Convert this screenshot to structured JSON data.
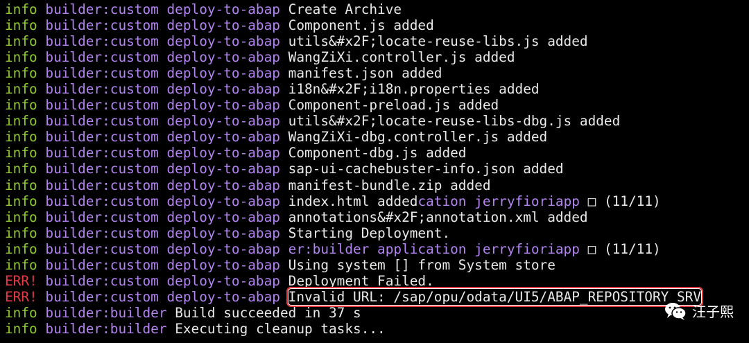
{
  "colors": {
    "info": "#8fcc2d",
    "err": "#e63b47",
    "source": "#b383f2",
    "msg": "#e9e9e9",
    "highlight_box": "#e0373d"
  },
  "terminal": {
    "lines": [
      {
        "level": "info",
        "source": "builder:custom deploy-to-abap",
        "message": "Create Archive"
      },
      {
        "level": "info",
        "source": "builder:custom deploy-to-abap",
        "message": "Component.js added"
      },
      {
        "level": "info",
        "source": "builder:custom deploy-to-abap",
        "message": "utils&#x2F;locate-reuse-libs.js added"
      },
      {
        "level": "info",
        "source": "builder:custom deploy-to-abap",
        "message": "WangZiXi.controller.js added"
      },
      {
        "level": "info",
        "source": "builder:custom deploy-to-abap",
        "message": "manifest.json added"
      },
      {
        "level": "info",
        "source": "builder:custom deploy-to-abap",
        "message": "i18n&#x2F;i18n.properties added"
      },
      {
        "level": "info",
        "source": "builder:custom deploy-to-abap",
        "message": "Component-preload.js added"
      },
      {
        "level": "info",
        "source": "builder:custom deploy-to-abap",
        "message": "utils&#x2F;locate-reuse-libs-dbg.js added"
      },
      {
        "level": "info",
        "source": "builder:custom deploy-to-abap",
        "message": "WangZiXi-dbg.controller.js added"
      },
      {
        "level": "info",
        "source": "builder:custom deploy-to-abap",
        "message": "Component-dbg.js added"
      },
      {
        "level": "info",
        "source": "builder:custom deploy-to-abap",
        "message": "sap-ui-cachebuster-info.json added"
      },
      {
        "level": "info",
        "source": "builder:custom deploy-to-abap",
        "message": "manifest-bundle.zip added"
      },
      {
        "level": "info",
        "source": "builder:custom deploy-to-abap",
        "message": "index.html added",
        "accent": "cation jerryfioriapp",
        "tail": " □ (11/11)"
      },
      {
        "level": "info",
        "source": "builder:custom deploy-to-abap",
        "message": "annotations&#x2F;annotation.xml added"
      },
      {
        "level": "info",
        "source": "builder:custom deploy-to-abap",
        "message": "Starting Deployment."
      },
      {
        "level": "info",
        "source": "builder:custom deploy-to-abap",
        "message": "",
        "accent": "er:builder application jerryfioriapp",
        "tail": " □ (11/11)"
      },
      {
        "level": "info",
        "source": "builder:custom deploy-to-abap",
        "message": "Using system [] from System store"
      },
      {
        "level": "ERR!",
        "source": "builder:custom deploy-to-abap",
        "message": "Deployment Failed."
      },
      {
        "level": "ERR!",
        "source": "builder:custom deploy-to-abap",
        "message": "Invalid URL: /sap/opu/odata/UI5/ABAP_REPOSITORY_SRV",
        "highlight": true
      },
      {
        "level": "info",
        "source": "builder:builder",
        "message": "Build succeeded in 37 s"
      },
      {
        "level": "info",
        "source": "builder:builder",
        "message": "Executing cleanup tasks..."
      }
    ]
  },
  "watermark": {
    "icon": "wechat-icon",
    "text": "汪子熙"
  }
}
